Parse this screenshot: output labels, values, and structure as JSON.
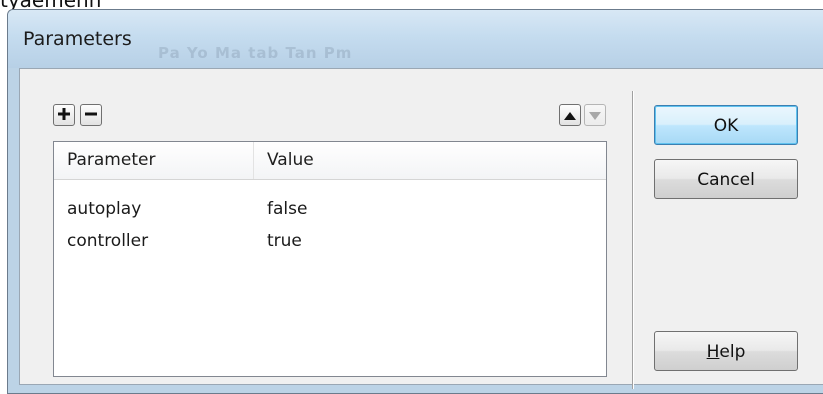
{
  "background_fragment": "tyaemenn",
  "window": {
    "title": "Parameters",
    "ghost_text": "Pa  Yo  Ma  tab Tan Pm"
  },
  "toolbar": {
    "add_icon": "plus-icon",
    "remove_icon": "minus-icon",
    "move_up_icon": "triangle-up-icon",
    "move_down_icon": "triangle-down-icon"
  },
  "table": {
    "columns": [
      "Parameter",
      "Value"
    ],
    "rows": [
      {
        "parameter": "autoplay",
        "value": "false"
      },
      {
        "parameter": "controller",
        "value": "true"
      }
    ]
  },
  "buttons": {
    "ok": "OK",
    "cancel": "Cancel",
    "help_mnemonic": "H",
    "help_rest": "elp"
  },
  "colors": {
    "titlebar": "#c5dcef",
    "client": "#f0f0f0",
    "default_button_border": "#3c7fb1"
  }
}
